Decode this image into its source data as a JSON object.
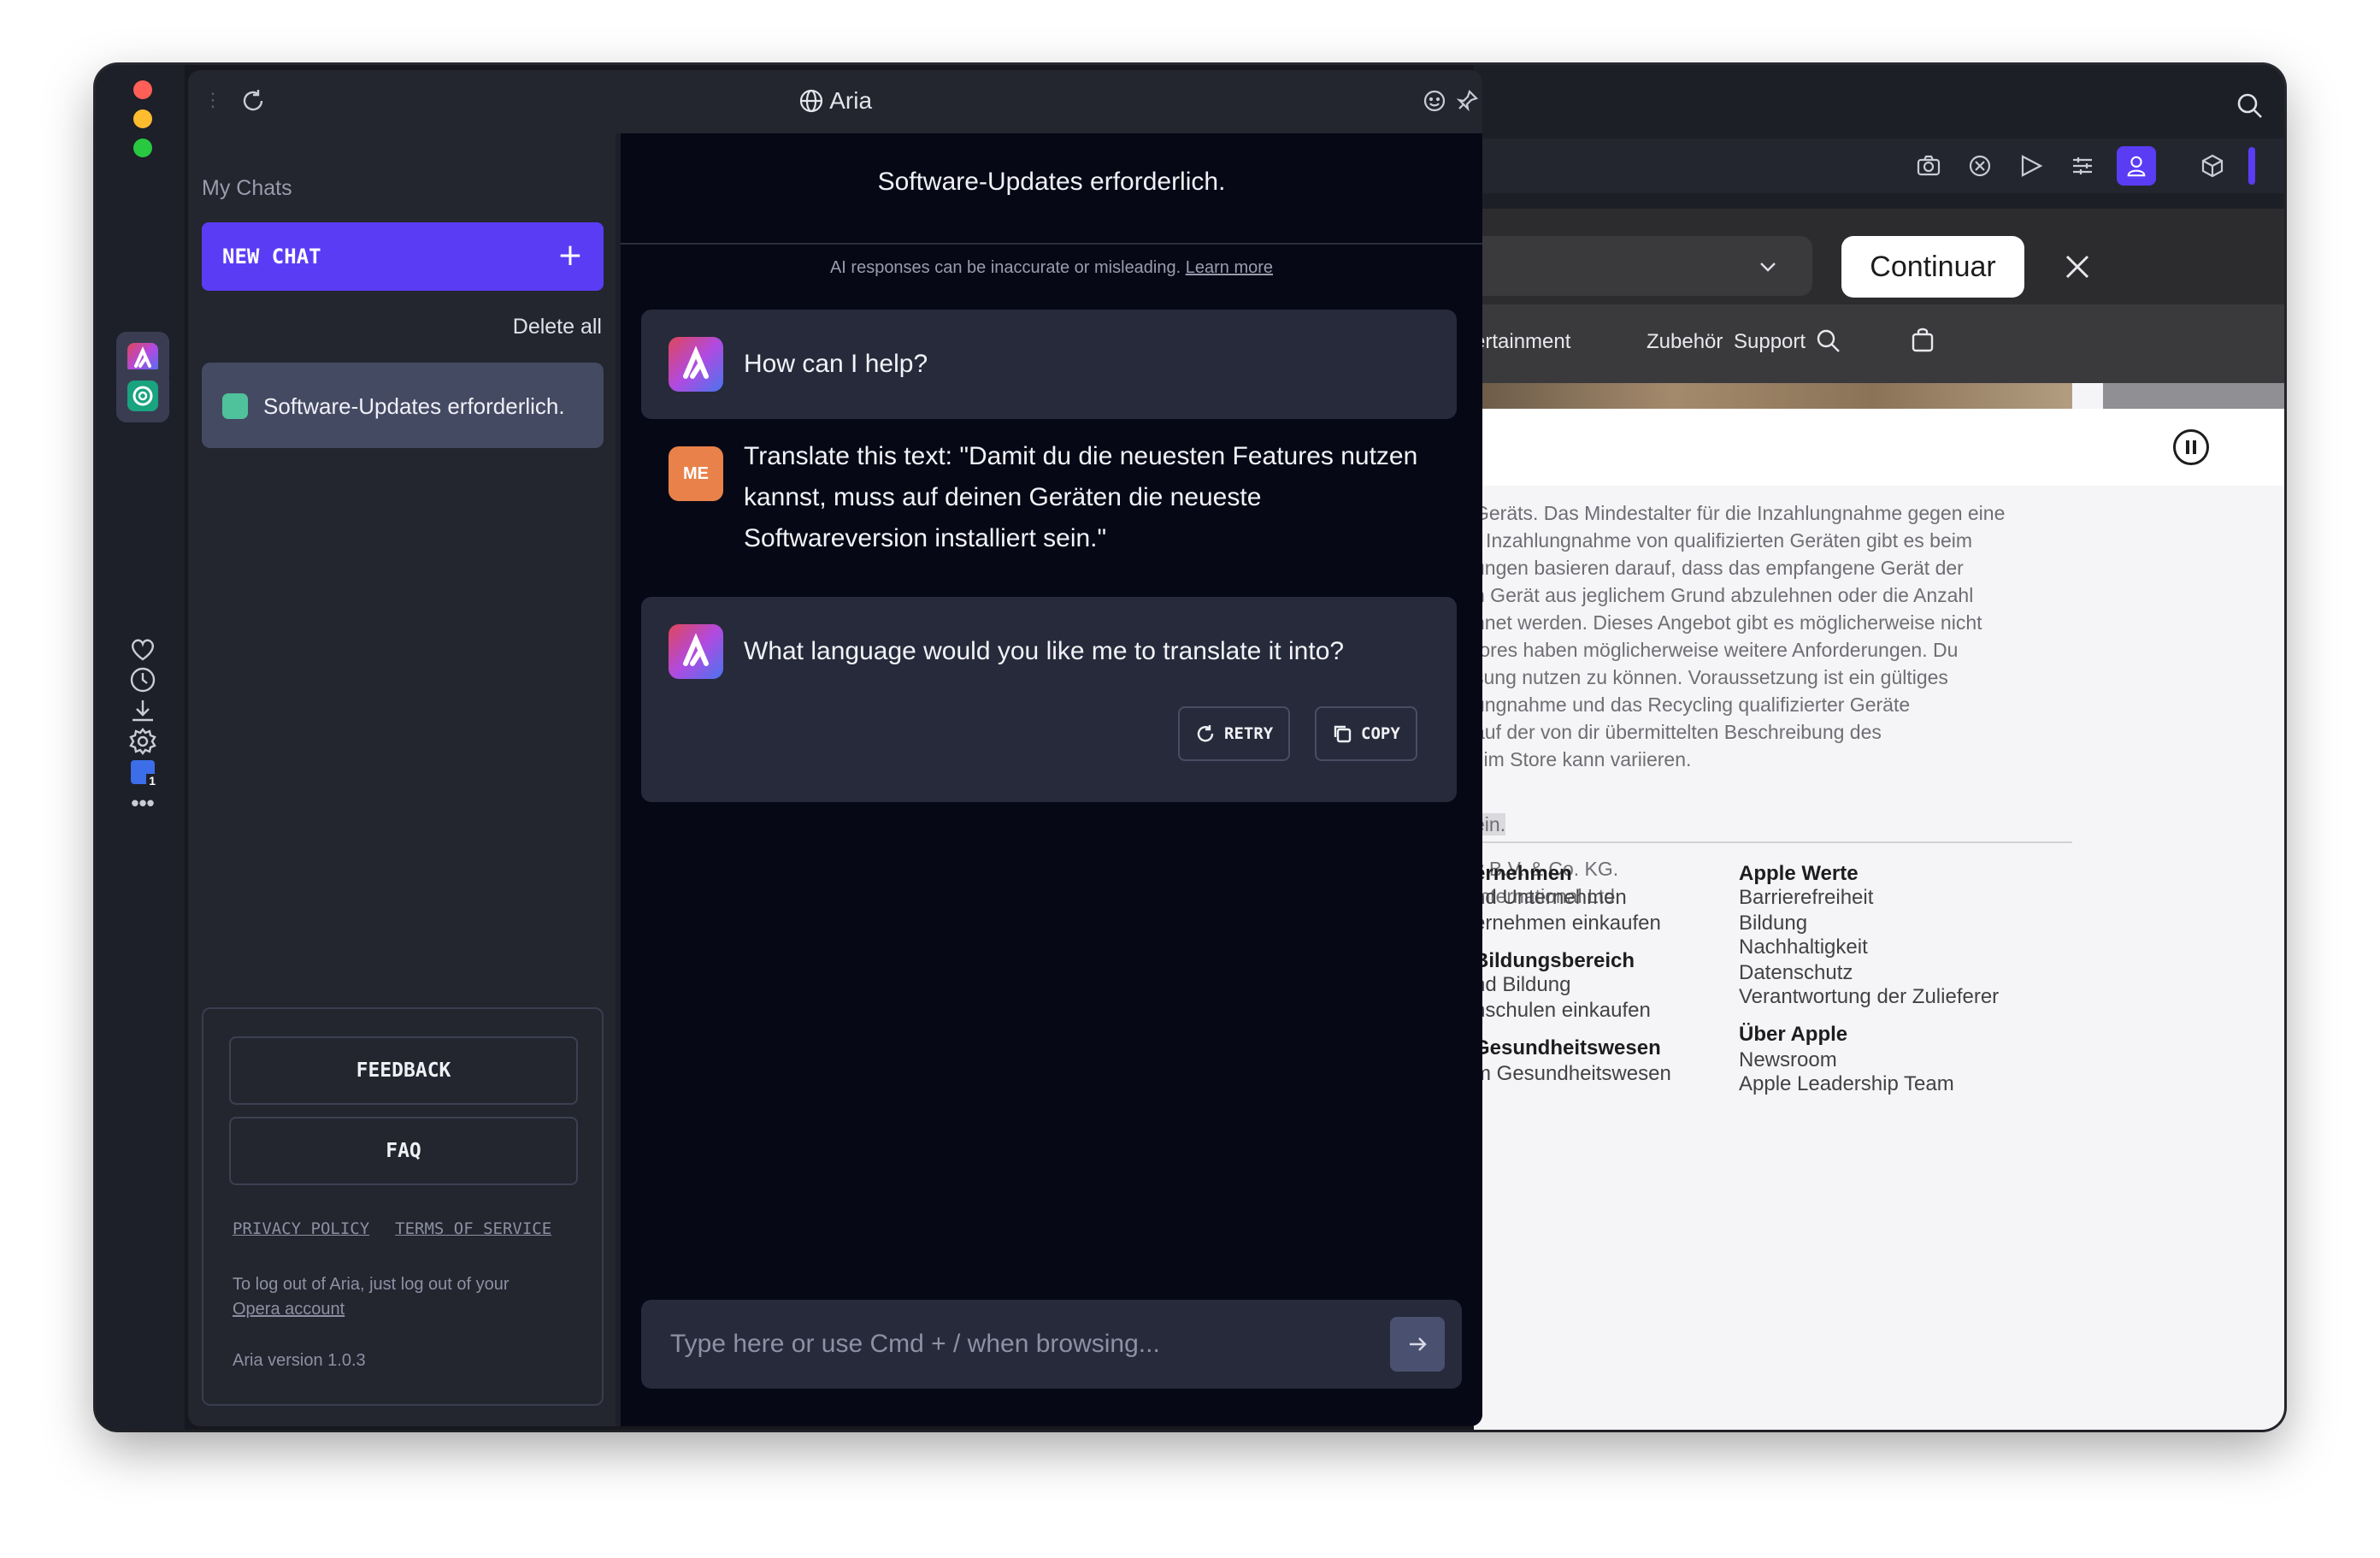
{
  "window": {
    "traffic_lights": {
      "close": "#ff5f57",
      "minimize": "#febc2e",
      "maximize": "#28c840"
    }
  },
  "leftbar": {
    "apps": [
      {
        "icon": "aria-app-icon"
      },
      {
        "icon": "chatgpt-app-icon"
      }
    ],
    "bottom_icons": [
      "heart-icon",
      "history-icon",
      "download-icon",
      "settings-icon",
      "vpn-badge-icon",
      "more-icon"
    ],
    "vpn_badge_count": "1"
  },
  "aria": {
    "title": "Aria",
    "sidebar": {
      "my_chats_label": "My Chats",
      "new_chat_label": "NEW CHAT",
      "new_chat_plus": "+",
      "delete_all_label": "Delete all",
      "chats": [
        {
          "title": "Software-Updates erforderlich.",
          "color": "#4fc29b"
        }
      ],
      "feedback_label": "FEEDBACK",
      "faq_label": "FAQ",
      "privacy_label": "PRIVACY POLICY",
      "terms_label": "TERMS OF SERVICE",
      "logout_text": "To log out of Aria, just log out of your",
      "logout_link": "Opera account",
      "version_text": "Aria version 1.0.3"
    },
    "chat": {
      "title": "Software-Updates erforderlich.",
      "disclaimer_text": "AI responses can be inaccurate or misleading.",
      "disclaimer_link": "Learn more",
      "messages": [
        {
          "role": "bot",
          "text": "How can I help?"
        },
        {
          "role": "user",
          "avatar": "ME",
          "lines": [
            "Translate this text: \"Damit du die neuesten Features nutzen",
            "kannst, muss auf deinen Geräten die neueste",
            "Softwareversion installiert sein.\""
          ]
        },
        {
          "role": "bot",
          "text": "What language would you like me to translate it into?"
        }
      ],
      "retry_label": "RETRY",
      "copy_label": "COPY",
      "input_placeholder": "Type here or use Cmd + / when browsing..."
    }
  },
  "browser": {
    "toolbar_icons": [
      "camera-icon",
      "adblock-icon",
      "send-icon",
      "easy-setup-icon",
      "profile-icon",
      "extensions-icon"
    ],
    "accent": "#5b3cf5",
    "banner": {
      "continue_label": "Continuar"
    },
    "nav": [
      "ertainment",
      "Zubehör",
      "Support"
    ],
    "legal_lines": [
      "Geräts. Das Mindestalter für die Inzahlungnahme gegen eine",
      "r Inzahlungnahme von qualifizierten Geräten gibt es beim",
      "ungen basieren darauf, dass das empfangene Gerät der",
      "n Gerät aus jeglichem Grund abzulehnen oder die Anzahl",
      "hnet werden. Dieses Angebot gibt es möglicherweise nicht",
      "tores haben möglicherweise weitere Anforderungen. Du",
      "sung nutzen zu können. Voraussetzung ist ein gültiges",
      "ungnahme und das Recycling qualifizierter Geräte",
      "auf der von dir übermittelten Beschreibung des",
      "l im Store kann variieren."
    ],
    "highlight_text": "ein.",
    "company_lines": [
      "y B.V. & Co. KG.",
      " International Ltd."
    ],
    "footer_col1": [
      {
        "text": "ernehmen",
        "heading": true
      },
      {
        "text": "nd Unternehmen"
      },
      {
        "text": "ernehmen einkaufen"
      },
      {
        "text": " Bildungsbereich",
        "heading": true
      },
      {
        "text": "nd Bildung"
      },
      {
        "text": "hschulen einkaufen"
      },
      {
        "text": " Gesundheitswesen",
        "heading": true
      },
      {
        "text": "m Gesundheitswesen"
      }
    ],
    "footer_col2": [
      {
        "text": "Apple Werte",
        "heading": true
      },
      {
        "text": "Barrierefreiheit"
      },
      {
        "text": "Bildung"
      },
      {
        "text": "Nachhaltigkeit"
      },
      {
        "text": "Datenschutz"
      },
      {
        "text": "Verantwortung der Zulieferer"
      },
      {
        "text": "Über Apple",
        "heading": true
      },
      {
        "text": "Newsroom"
      },
      {
        "text": "Apple Leadership Team"
      }
    ]
  }
}
